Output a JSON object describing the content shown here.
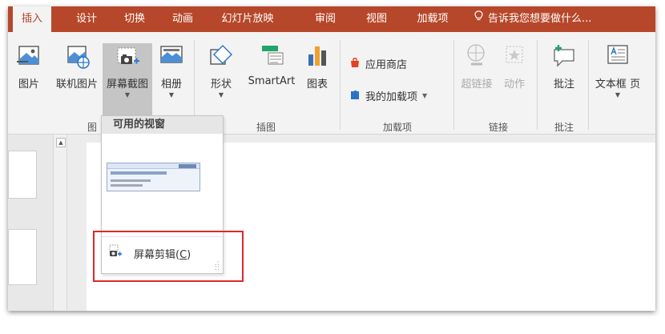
{
  "tabs": {
    "insert": "插入",
    "design": "设计",
    "transitions": "切换",
    "animations": "动画",
    "slideshow": "幻灯片放映",
    "review": "审阅",
    "view": "视图",
    "addins": "加载项"
  },
  "tell_me": "告诉我您想要做什么...",
  "ribbon": {
    "pictures": "图片",
    "online_pictures": "联机图片",
    "screenshot": "屏幕截图",
    "album": "相册",
    "shapes": "形状",
    "smartart": "SmartArt",
    "chart": "图表",
    "store": "应用商店",
    "my_addins": "我的加载项",
    "hyperlink": "超链接",
    "action": "动作",
    "comment": "批注",
    "textbox": "文本框",
    "textbox_extra": "页",
    "group_images": "图",
    "group_illustrations": "插图",
    "group_addins": "加载项",
    "group_links": "链接",
    "group_comments": "批注"
  },
  "dropdown": {
    "header": "可用的视窗",
    "clipping": "屏幕剪辑",
    "shortcut": "C"
  },
  "colors": {
    "accent": "#b7472a",
    "highlight_border": "#e02727"
  }
}
